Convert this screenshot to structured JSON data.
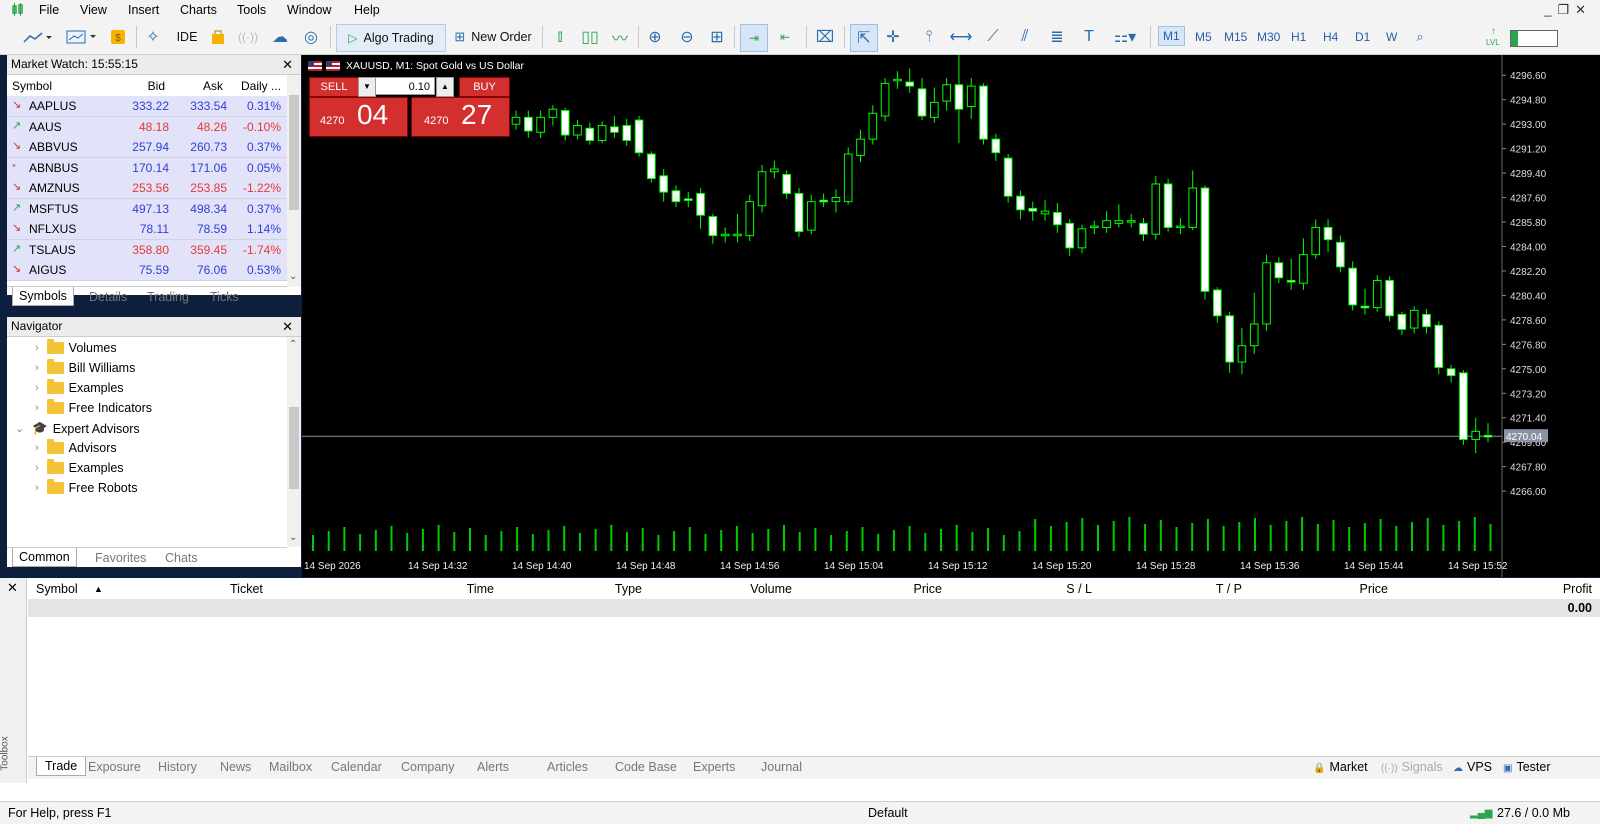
{
  "menu": [
    "File",
    "View",
    "Insert",
    "Charts",
    "Tools",
    "Window",
    "Help"
  ],
  "toolbar": {
    "ide_label": "IDE",
    "algo_trading_label": "Algo Trading",
    "new_order_label": "New Order",
    "timeframes": [
      "M1",
      "M5",
      "M15",
      "M30",
      "H1",
      "H4",
      "D1",
      "W"
    ],
    "selected_timeframe": "M1",
    "lvl_label": "LVL"
  },
  "market_watch": {
    "title": "Market Watch: 15:55:15",
    "columns": [
      "Symbol",
      "Bid",
      "Ask",
      "Daily ..."
    ],
    "rows": [
      {
        "symbol": "AAPLUS",
        "bid": "333.22",
        "ask": "333.54",
        "daily": "0.31%",
        "dir": "down"
      },
      {
        "symbol": "AAUS",
        "bid": "48.18",
        "ask": "48.26",
        "daily": "-0.10%",
        "dir": "up"
      },
      {
        "symbol": "ABBVUS",
        "bid": "257.94",
        "ask": "260.73",
        "daily": "0.37%",
        "dir": "down"
      },
      {
        "symbol": "ABNBUS",
        "bid": "170.14",
        "ask": "171.06",
        "daily": "0.05%",
        "dir": "flat"
      },
      {
        "symbol": "AMZNUS",
        "bid": "253.56",
        "ask": "253.85",
        "daily": "-1.22%",
        "dir": "down"
      },
      {
        "symbol": "MSFTUS",
        "bid": "497.13",
        "ask": "498.34",
        "daily": "0.37%",
        "dir": "up"
      },
      {
        "symbol": "NFLXUS",
        "bid": "78.11",
        "ask": "78.59",
        "daily": "1.14%",
        "dir": "down"
      },
      {
        "symbol": "TSLAUS",
        "bid": "358.80",
        "ask": "359.45",
        "daily": "-1.74%",
        "dir": "up"
      },
      {
        "symbol": "AIGUS",
        "bid": "75.59",
        "ask": "76.06",
        "daily": "0.53%",
        "dir": "down"
      }
    ],
    "tabs": [
      "Symbols",
      "Details",
      "Trading",
      "Ticks"
    ]
  },
  "navigator": {
    "title": "Navigator",
    "items": [
      {
        "label": "Volumes",
        "level": 2
      },
      {
        "label": "Bill Williams",
        "level": 2
      },
      {
        "label": "Examples",
        "level": 2
      },
      {
        "label": "Free Indicators",
        "level": 2
      },
      {
        "label": "Expert Advisors",
        "level": 1
      },
      {
        "label": "Advisors",
        "level": 2
      },
      {
        "label": "Examples",
        "level": 2
      },
      {
        "label": "Free Robots",
        "level": 2
      }
    ],
    "tabs": [
      "Common",
      "Favorites",
      "Chats"
    ]
  },
  "chart": {
    "title": "XAUUSD, M1:  Spot Gold vs US Dollar",
    "sell_label": "SELL",
    "buy_label": "BUY",
    "volume": "0.10",
    "sell_price_small": "4270",
    "sell_price_big": "04",
    "buy_price_small": "4270",
    "buy_price_big": "27",
    "current_price": "4270.04",
    "price_ticks": [
      "4296.60",
      "4294.80",
      "4293.00",
      "4291.20",
      "4289.40",
      "4287.60",
      "4285.80",
      "4284.00",
      "4282.20",
      "4280.40",
      "4278.60",
      "4276.80",
      "4275.00",
      "4273.20",
      "4271.40",
      "4269.60",
      "4267.80",
      "4266.00"
    ],
    "time_ticks": [
      "14 Sep 2026",
      "14 Sep 14:32",
      "14 Sep 14:40",
      "14 Sep 14:48",
      "14 Sep 14:56",
      "14 Sep 15:04",
      "14 Sep 15:12",
      "14 Sep 15:20",
      "14 Sep 15:28",
      "14 Sep 15:36",
      "14 Sep 15:44",
      "14 Sep 15:52"
    ],
    "colors": {
      "background": "#000000",
      "bull_body": "#000000",
      "bear_body": "#ffffff",
      "wick": "#00ff00",
      "volume": "#00cc00",
      "grid_line": "#8a93a6"
    }
  },
  "toolbox": {
    "side_label": "Toolbox",
    "columns": [
      "Symbol",
      "Ticket",
      "Time",
      "Type",
      "Volume",
      "Price",
      "S / L",
      "T / P",
      "Price",
      "Profit"
    ],
    "profit_total": "0.00",
    "tabs": [
      "Trade",
      "Exposure",
      "History",
      "News",
      "Mailbox",
      "Calendar",
      "Company",
      "Alerts",
      "Articles",
      "Code Base",
      "Experts",
      "Journal"
    ],
    "right_items": [
      "Market",
      "Signals",
      "VPS",
      "Tester"
    ]
  },
  "statusbar": {
    "help": "For Help, press F1",
    "profile": "Default",
    "traffic": "27.6 / 0.0 Mb"
  }
}
